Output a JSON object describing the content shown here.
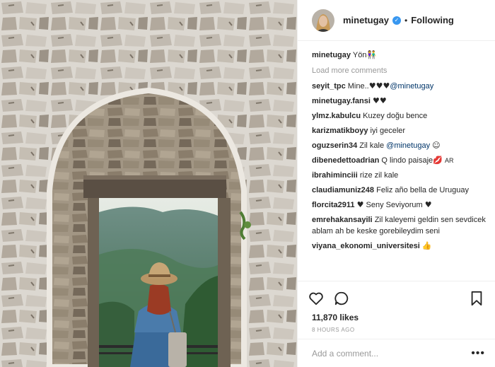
{
  "header": {
    "username": "minetugay",
    "verified_mark": "✓",
    "separator": "•",
    "follow_label": "Following"
  },
  "caption": {
    "user": "minetugay",
    "text": "Yön",
    "emoji": "👫"
  },
  "load_more_label": "Load more comments",
  "comments": [
    {
      "user": "seyit_tpc",
      "text": "Mine..",
      "hearts": "♥♥♥",
      "mention": "@minetugay"
    },
    {
      "user": "minetugay.fansi",
      "hearts": "♥♥"
    },
    {
      "user": "ylmz.kabulcu",
      "text": "Kuzey doğu bence"
    },
    {
      "user": "karizmatikboyy",
      "text": "iyi geceler"
    },
    {
      "user": "oguzserin34",
      "text": "Zil kale",
      "mention": "@minetugay",
      "emoji": "☺"
    },
    {
      "user": "dibenedettoadrian",
      "text": "Q lindo paisaje",
      "emoji": "💋",
      "suffix": "AR"
    },
    {
      "user": "ibrahiminciii",
      "text": "rize zil kale"
    },
    {
      "user": "claudiamuniz248",
      "text": "Feliz año bella de Uruguay"
    },
    {
      "user": "florcita2911",
      "heart_a": "♥",
      "text": "Seny Seviyorum",
      "heart_b": "♥"
    },
    {
      "user": "emrehakansayili",
      "text": "Zil kaleyemi geldin sen sevdicek ablam ah be keske gorebileydim seni"
    },
    {
      "user": "viyana_ekonomi_universitesi",
      "emoji": "👍"
    }
  ],
  "likes": "11,870 likes",
  "time": "8 HOURS AGO",
  "add_comment_placeholder": "Add a comment...",
  "more_label": "•••",
  "icons": [
    "heart-icon",
    "comment-icon",
    "bookmark-icon"
  ],
  "colors": {
    "link": "#003569",
    "verified": "#3897f0",
    "muted": "#999999"
  }
}
